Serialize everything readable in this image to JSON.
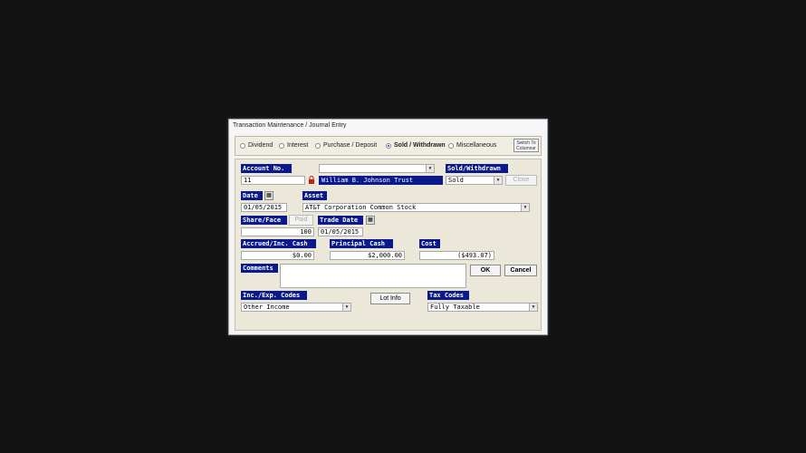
{
  "window": {
    "title": "Transaction Maintenance / Journal Entry"
  },
  "radio_options": [
    {
      "label": "Dividend",
      "selected": false
    },
    {
      "label": "Interest",
      "selected": false
    },
    {
      "label": "Purchase / Deposit",
      "selected": false
    },
    {
      "label": "Sold / Withdrawn",
      "selected": true
    },
    {
      "label": "Miscellaneous",
      "selected": false
    }
  ],
  "switch_button": {
    "line1": "Switch To",
    "line2": "Columnar"
  },
  "account": {
    "label": "Account No.",
    "value": "11",
    "name": "William B. Johnson Trust",
    "lookup_value": ""
  },
  "sold_withdrawn": {
    "label": "Sold/Withdrawn",
    "value": "Sold",
    "close_label": "Close"
  },
  "date": {
    "label": "Date",
    "value": "01/05/2015"
  },
  "asset": {
    "label": "Asset",
    "value": "AT&T Corporation Common Stock"
  },
  "share_face": {
    "label": "Share/Face",
    "value": "100",
    "paid_label": "Paid"
  },
  "trade_date": {
    "label": "Trade Date",
    "value": "01/05/2015"
  },
  "accrued": {
    "label": "Accrued/Inc. Cash",
    "value": "$0.00"
  },
  "principal": {
    "label": "Principal Cash",
    "value": "$2,000.00"
  },
  "cost": {
    "label": "Cost",
    "value": "($493.07)"
  },
  "comments": {
    "label": "Comments",
    "value": ""
  },
  "buttons": {
    "ok": "OK",
    "cancel": "Cancel",
    "lot_info": "Lot Info"
  },
  "inc_exp": {
    "label": "Inc./Exp. Codes",
    "value": "Other Income"
  },
  "tax": {
    "label": "Tax Codes",
    "value": "Fully Taxable"
  },
  "colors": {
    "label_bg": "#0a1a8c",
    "panel_bg": "#ece8d9",
    "desktop": "#121212"
  }
}
